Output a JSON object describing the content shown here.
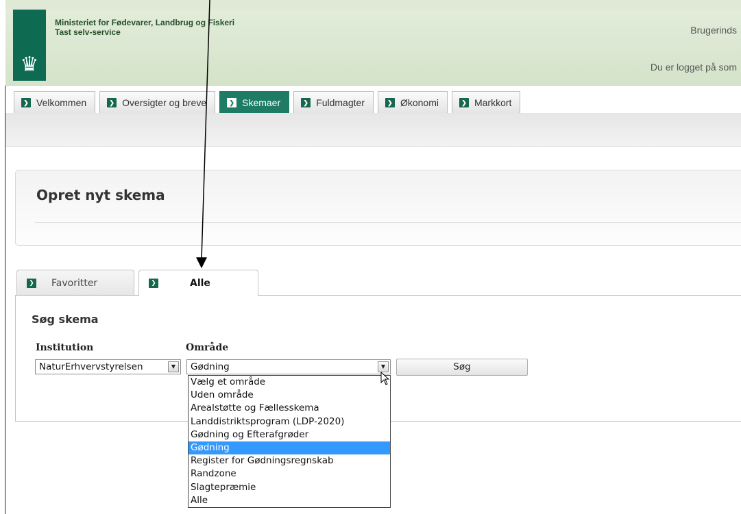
{
  "header": {
    "ministry_line1": "Ministeriet for Fødevarer, Landbrug og Fiskeri",
    "ministry_line2": "Tast selv-service",
    "brugerind": "Brugerinds",
    "logged_in": "Du er logget på som",
    "crown_icon": "crown-icon"
  },
  "main_tabs": [
    {
      "label": "Velkommen"
    },
    {
      "label": "Oversigter og breve"
    },
    {
      "label": "Skemaer",
      "active": true
    },
    {
      "label": "Fuldmagter"
    },
    {
      "label": "Økonomi"
    },
    {
      "label": "Markkort"
    }
  ],
  "page": {
    "title": "Opret nyt skema"
  },
  "sub_tabs": {
    "favorites": "Favoritter",
    "all": "Alle"
  },
  "search": {
    "title": "Søg skema",
    "institution_label": "Institution",
    "area_label": "Område",
    "institution_value": "NaturErhvervstyrelsen",
    "area_value": "Gødning",
    "button_label": "Søg"
  },
  "area_options": [
    "Vælg et område",
    "Uden område",
    "Arealstøtte og Fællesskema",
    "Landdistriktsprogram (LDP-2020)",
    "Gødning og Efterafgrøder",
    "Gødning",
    "Register for Gødningsregnskab",
    "Randzone",
    "Slagtepræmie",
    "Alle"
  ],
  "selected_option_index": 5,
  "colors": {
    "accent": "#1d7c63",
    "highlight": "#3399ff"
  }
}
